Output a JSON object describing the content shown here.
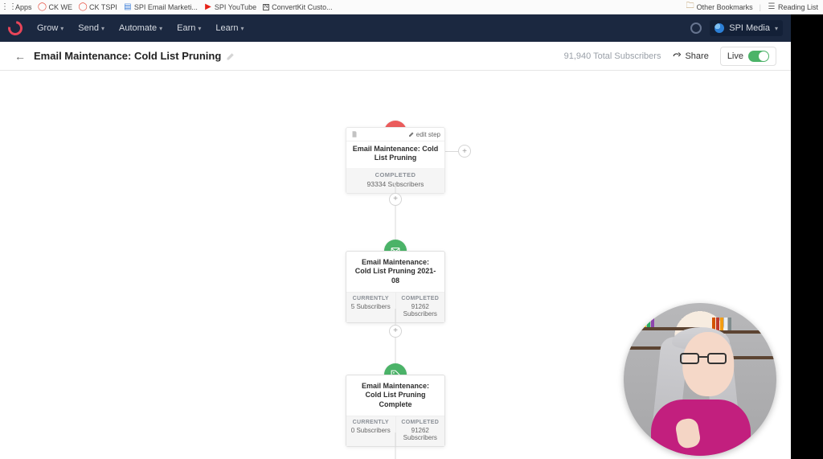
{
  "bookmarks": {
    "left": [
      {
        "icon": "grid",
        "label": "Apps"
      },
      {
        "icon": "ck",
        "label": "CK WE"
      },
      {
        "icon": "ck",
        "label": "CK TSPI"
      },
      {
        "icon": "doc-blue",
        "label": "SPI Email Marketi..."
      },
      {
        "icon": "yt",
        "label": "SPI YouTube"
      },
      {
        "icon": "notion",
        "label": "ConvertKit Custo..."
      }
    ],
    "right": [
      {
        "icon": "folder",
        "label": "Other Bookmarks"
      },
      {
        "icon": "list",
        "label": "Reading List"
      }
    ]
  },
  "topnav": {
    "items": [
      "Grow",
      "Send",
      "Automate",
      "Earn",
      "Learn"
    ],
    "account": "SPI Media"
  },
  "pagebar": {
    "title": "Email Maintenance: Cold List Pruning",
    "subscribers": "91,940 Total Subscribers",
    "share": "Share",
    "live": "Live"
  },
  "flow": {
    "entry": {
      "edit_label": "edit step",
      "title": "Email Maintenance: Cold List Pruning",
      "status_label": "COMPLETED",
      "status_value": "93334 Subscribers"
    },
    "steps": [
      {
        "icon": "mail",
        "title": "Email Maintenance: Cold List Pruning 2021-08",
        "currently_label": "CURRENTLY",
        "currently_value": "5 Subscribers",
        "completed_label": "COMPLETED",
        "completed_value": "91262 Subscribers"
      },
      {
        "icon": "tag",
        "title": "Email Maintenance: Cold List Pruning Complete",
        "currently_label": "CURRENTLY",
        "currently_value": "0 Subscribers",
        "completed_label": "COMPLETED",
        "completed_value": "91262 Subscribers"
      }
    ]
  }
}
